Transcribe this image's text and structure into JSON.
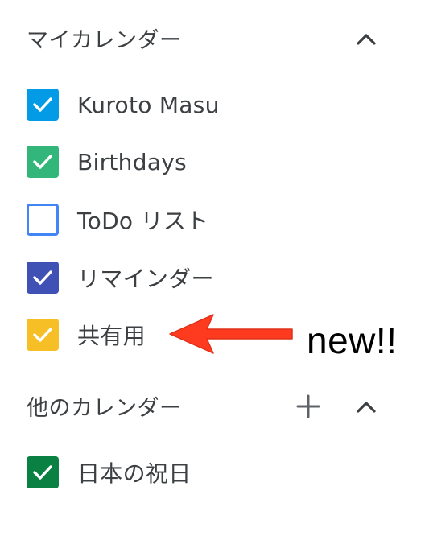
{
  "my_calendars": {
    "title": "マイカレンダー",
    "collapse_icon": "chevron-up-icon",
    "items": [
      {
        "label": "Kuroto Masu",
        "color": "#039be5",
        "checked": true
      },
      {
        "label": "Birthdays",
        "color": "#33b679",
        "checked": true
      },
      {
        "label": "ToDo リスト",
        "color": "#4285f4",
        "checked": false
      },
      {
        "label": "リマインダー",
        "color": "#3f51b5",
        "checked": true
      },
      {
        "label": "共有用",
        "color": "#f6bf26",
        "checked": true
      }
    ]
  },
  "other_calendars": {
    "title": "他のカレンダー",
    "add_icon": "plus-icon",
    "collapse_icon": "chevron-up-icon",
    "items": [
      {
        "label": "日本の祝日",
        "color": "#0b8043",
        "checked": true
      }
    ]
  },
  "annotation": {
    "text": "new!!",
    "arrow_color": "#ff3b1f"
  }
}
